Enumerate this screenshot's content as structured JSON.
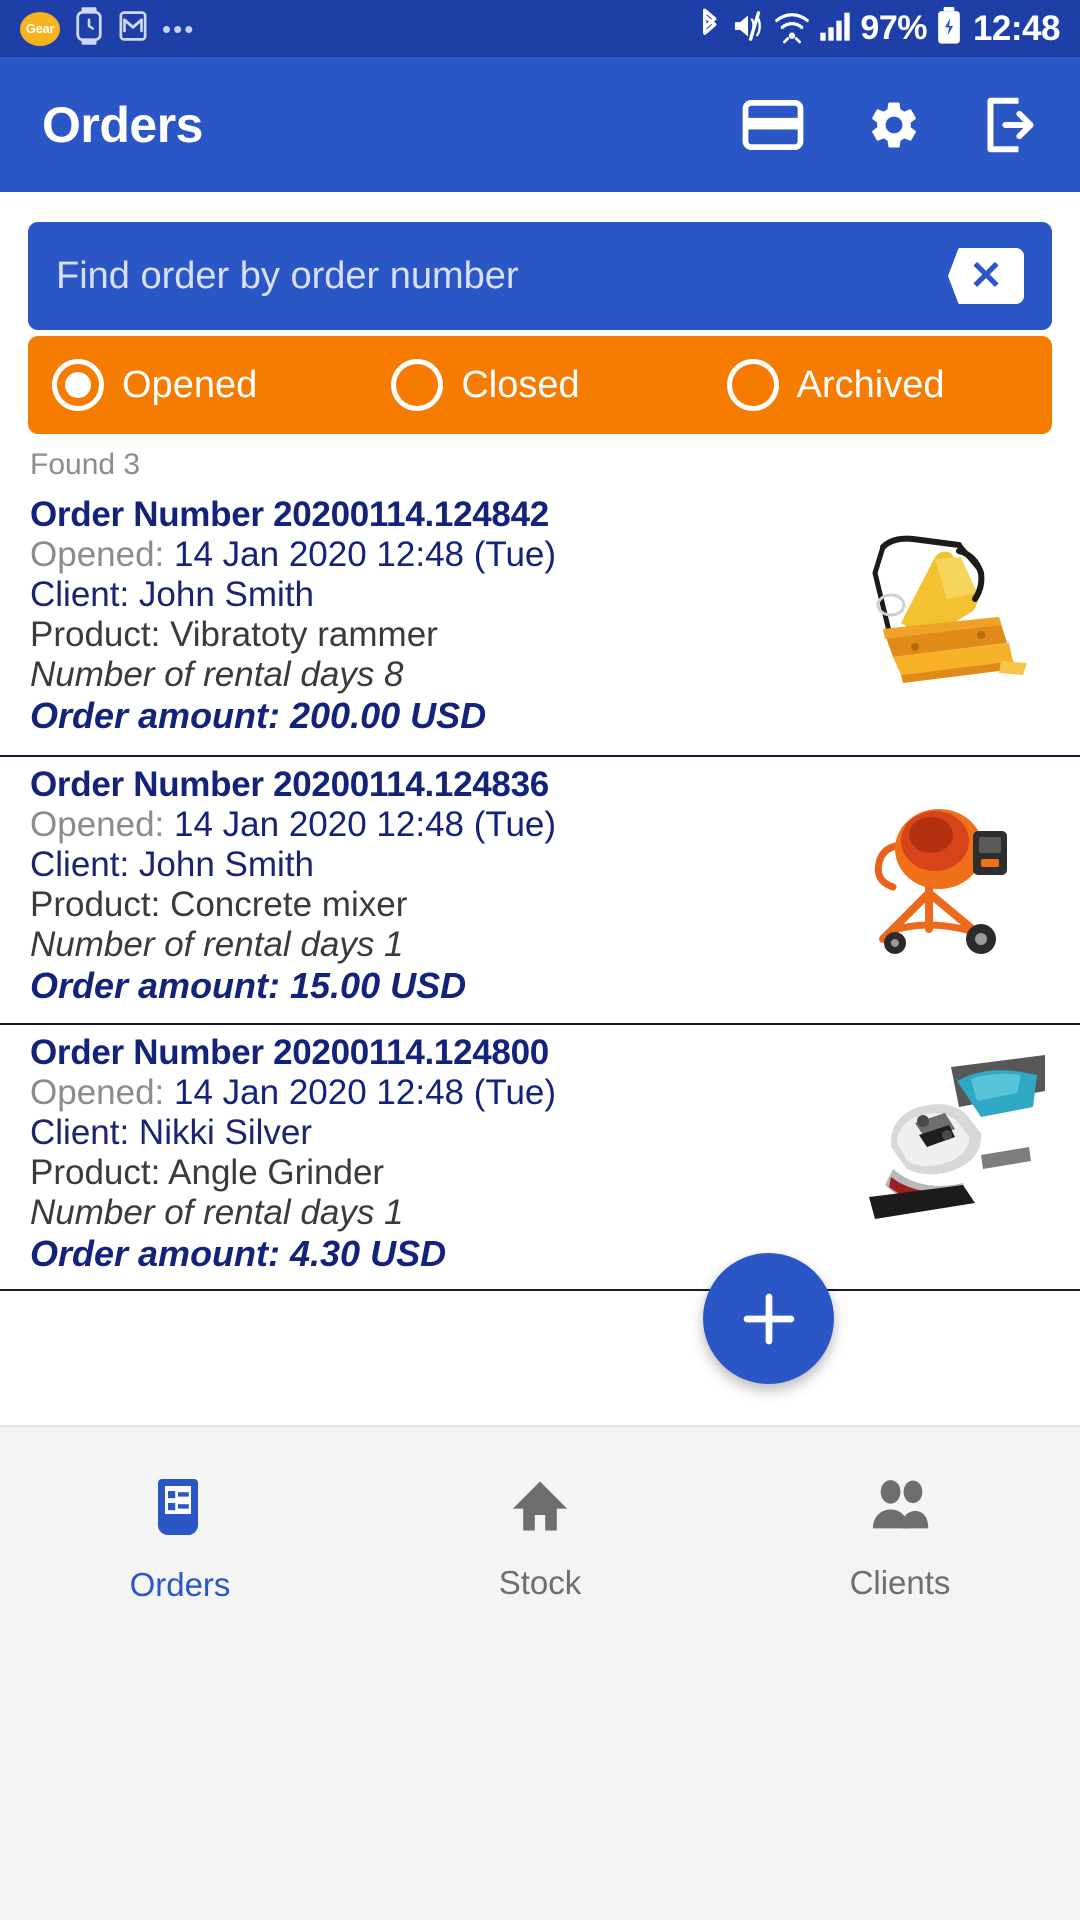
{
  "status_bar": {
    "left_icons": [
      "gear-badge-icon",
      "watch-icon",
      "gmail-icon",
      "overflow-dots-icon"
    ],
    "gear_badge_label": "Gear",
    "right_icons": [
      "bluetooth-icon",
      "mute-icon",
      "wifi-icon",
      "signal-icon",
      "battery-icon"
    ],
    "battery_percent": "97%",
    "time": "12:48"
  },
  "app_bar": {
    "title": "Orders",
    "actions": [
      {
        "name": "card-icon"
      },
      {
        "name": "gear-icon"
      },
      {
        "name": "exit-icon"
      }
    ]
  },
  "search": {
    "placeholder": "Find order by order number",
    "value": "",
    "clear_label": "✕"
  },
  "filters": {
    "options": [
      {
        "label": "Opened",
        "selected": true
      },
      {
        "label": "Closed",
        "selected": false
      },
      {
        "label": "Archived",
        "selected": false
      }
    ]
  },
  "results": {
    "found_text": "Found 3",
    "count": 3,
    "orders": [
      {
        "number_label": "Order Number 20200114.124842",
        "opened_label": "Opened:",
        "opened_value": "14 Jan 2020 12:48 (Tue)",
        "client": "Client: John Smith",
        "product": "Product: Vibratoty rammer",
        "rental_days": "Number of rental days 8",
        "amount": "Order amount: 200.00 USD",
        "thumb": "vibratory-rammer-image"
      },
      {
        "number_label": "Order Number 20200114.124836",
        "opened_label": "Opened:",
        "opened_value": "14 Jan 2020 12:48 (Tue)",
        "client": "Client: John Smith",
        "product": "Product: Concrete mixer",
        "rental_days": "Number of rental days 1",
        "amount": "Order amount: 15.00 USD",
        "thumb": "concrete-mixer-image"
      },
      {
        "number_label": "Order Number 20200114.124800",
        "opened_label": "Opened:",
        "opened_value": "14 Jan 2020 12:48 (Tue)",
        "client": "Client: Nikki Silver",
        "product": "Product: Angle Grinder",
        "rental_days": "Number of rental days 1",
        "amount": "Order amount: 4.30 USD",
        "thumb": "angle-grinder-image"
      }
    ]
  },
  "fab": {
    "label": "+",
    "name": "add-order-button"
  },
  "bottom_nav": {
    "items": [
      {
        "label": "Orders",
        "icon": "orders-receipt-icon",
        "active": true
      },
      {
        "label": "Stock",
        "icon": "home-icon",
        "active": false
      },
      {
        "label": "Clients",
        "icon": "people-icon",
        "active": false
      }
    ]
  },
  "colors": {
    "status_bar": "#1E3FA8",
    "app_bar": "#2B56C6",
    "accent_orange": "#F57C00",
    "navy_text": "#14237A",
    "gray_text": "#8C8C8C",
    "nav_bg": "#F4F4F4"
  }
}
